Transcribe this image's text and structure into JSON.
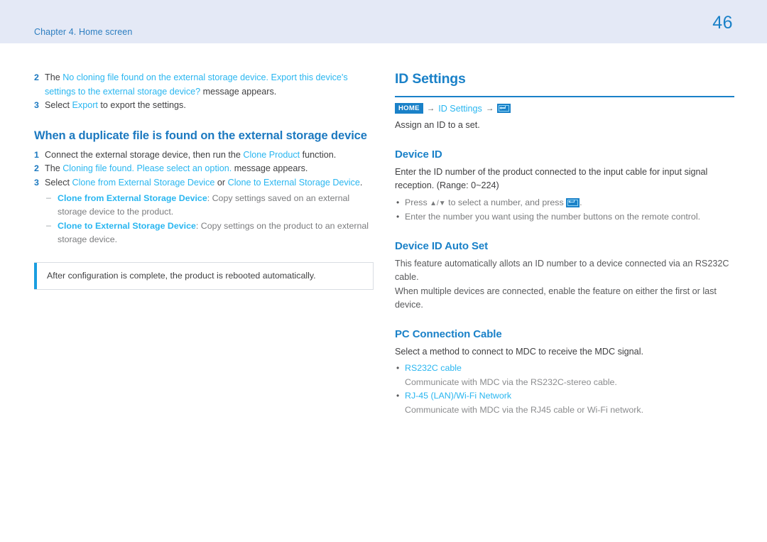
{
  "header": {
    "chapter": "Chapter 4. Home screen",
    "page_number": "46",
    "band_color": "#e4e9f6",
    "accent_color": "#1a81c8",
    "link_color": "#29b6f0"
  },
  "left_column": {
    "steps_top": [
      {
        "num": "2",
        "prefix": "The ",
        "link": "No cloning file found on the external storage device. Export this device's settings to the external storage device?",
        "suffix": " message appears."
      },
      {
        "num": "3",
        "prefix": "Select ",
        "link": "Export",
        "suffix": " to export the settings."
      }
    ],
    "heading": "When a duplicate file is found on the external storage device",
    "steps_bottom": [
      {
        "num": "1",
        "prefix": "Connect the external storage device, then run the ",
        "link": "Clone Product",
        "suffix": " function."
      },
      {
        "num": "2",
        "prefix": "The ",
        "link": "Cloning file found. Please select an option.",
        "suffix": " message appears."
      },
      {
        "num": "3",
        "prefix": "Select ",
        "link": "Clone from External Storage Device",
        "mid": " or ",
        "link2": "Clone to External Storage Device",
        "suffix": "."
      }
    ],
    "sub_items": [
      {
        "dash": "–",
        "term": "Clone from External Storage Device",
        "desc": ": Copy settings saved on an external storage device to the product."
      },
      {
        "dash": "–",
        "term": "Clone to External Storage Device",
        "desc": ": Copy settings on the product to an external storage device."
      }
    ],
    "note": "After configuration is complete, the product is rebooted automatically."
  },
  "right_column": {
    "title": "ID Settings",
    "breadcrumb": {
      "home_label": "HOME",
      "arrow": "→",
      "path_label": "ID Settings",
      "enter_icon": "enter-key-icon"
    },
    "intro": "Assign an ID to a set.",
    "sections": [
      {
        "heading": "Device ID",
        "paragraphs": [
          "Enter the ID number of the product connected to the input cable for input signal reception. (Range: 0~224)"
        ],
        "bullets": [
          {
            "prefix": "Press ",
            "keys": "▲/▼",
            "mid": " to select a number, and press ",
            "has_enter_icon": true,
            "suffix": "."
          },
          {
            "prefix": "Enter the number you want using the number buttons on the remote control.",
            "has_enter_icon": false
          }
        ]
      },
      {
        "heading": "Device ID Auto Set",
        "paragraphs": [
          "This feature automatically allots an ID number to a device connected via an RS232C cable.",
          "When multiple devices are connected, enable the feature on either the first or last device."
        ],
        "bullets": []
      },
      {
        "heading": "PC Connection Cable",
        "paragraphs": [
          "Select a method to connect to MDC to receive the MDC signal."
        ],
        "option_bullets": [
          {
            "term": "RS232C cable",
            "desc": "Communicate with MDC via the RS232C-stereo cable."
          },
          {
            "term": "RJ-45 (LAN)/Wi-Fi Network",
            "desc": "Communicate with MDC via the RJ45 cable or Wi-Fi network."
          }
        ]
      }
    ]
  }
}
